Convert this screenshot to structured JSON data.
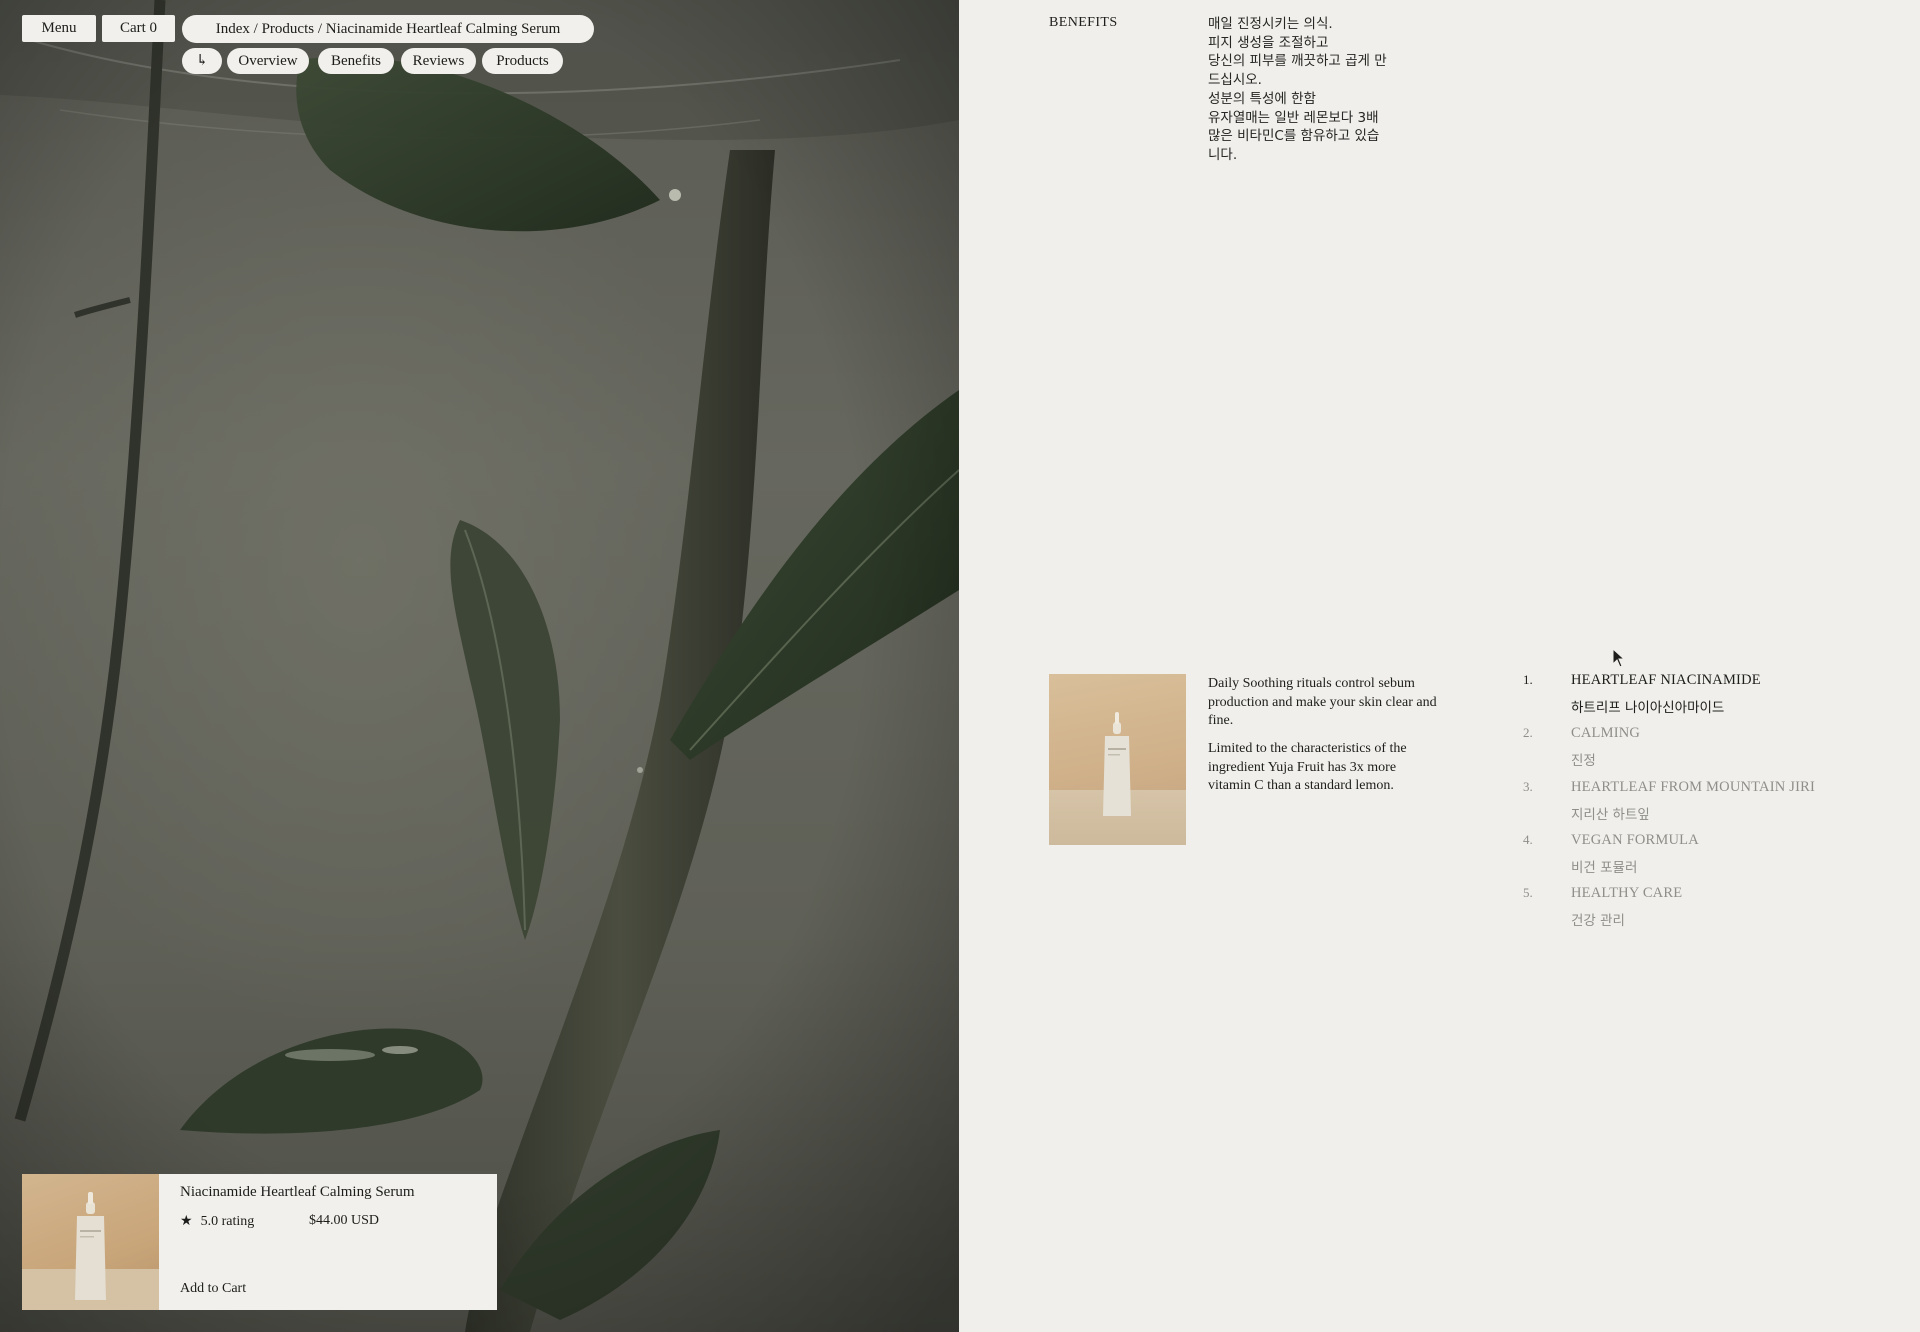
{
  "nav": {
    "menu_label": "Menu",
    "cart_label": "Cart 0",
    "breadcrumb": "Index / Products / Niacinamide Heartleaf Calming Serum",
    "back_icon": "↳",
    "tabs": [
      {
        "label": "Overview"
      },
      {
        "label": "Benefits"
      },
      {
        "label": "Reviews"
      },
      {
        "label": "Products"
      }
    ]
  },
  "product_card": {
    "title": "Niacinamide Heartleaf Calming Serum",
    "star_icon": "★",
    "rating": "5.0 rating",
    "price": "$44.00 USD",
    "add_to_cart": "Add to Cart"
  },
  "benefits": {
    "section_label": "BENEFITS",
    "korean_lines": [
      "매일 진정시키는 의식.",
      "피지 생성을 조절하고",
      "당신의 피부를 깨끗하고 곱게 만",
      "드십시오.",
      "성분의 특성에 한함",
      "유자열매는 일반 레몬보다 3배",
      "많은 비타민C를 함유하고 있습",
      "니다."
    ],
    "description_1": "Daily Soothing rituals control sebum production and make your skin clear and fine.",
    "description_2": "Limited to the characteristics of the ingredient Yuja Fruit has 3x more vitamin C than a standard lemon.",
    "features": [
      {
        "num": "1.",
        "en": "HEARTLEAF NIACINAMIDE",
        "ko": "하트리프 나이아신아마이드",
        "active": true
      },
      {
        "num": "2.",
        "en": "CALMING",
        "ko": "진정",
        "active": false
      },
      {
        "num": "3.",
        "en": "HEARTLEAF FROM MOUNTAIN JIRI",
        "ko": "지리산 하트잎",
        "active": false
      },
      {
        "num": "4.",
        "en": "VEGAN FORMULA",
        "ko": "비건 포뮬러",
        "active": false
      },
      {
        "num": "5.",
        "en": "HEALTHY CARE",
        "ko": "건강 관리",
        "active": false
      }
    ]
  },
  "colors": {
    "page_bg": "#f0efeb",
    "pill_bg": "#f1f0ec",
    "text": "#1d1d1b",
    "muted": "#8f8e89",
    "product_bg": "#cfb089"
  }
}
